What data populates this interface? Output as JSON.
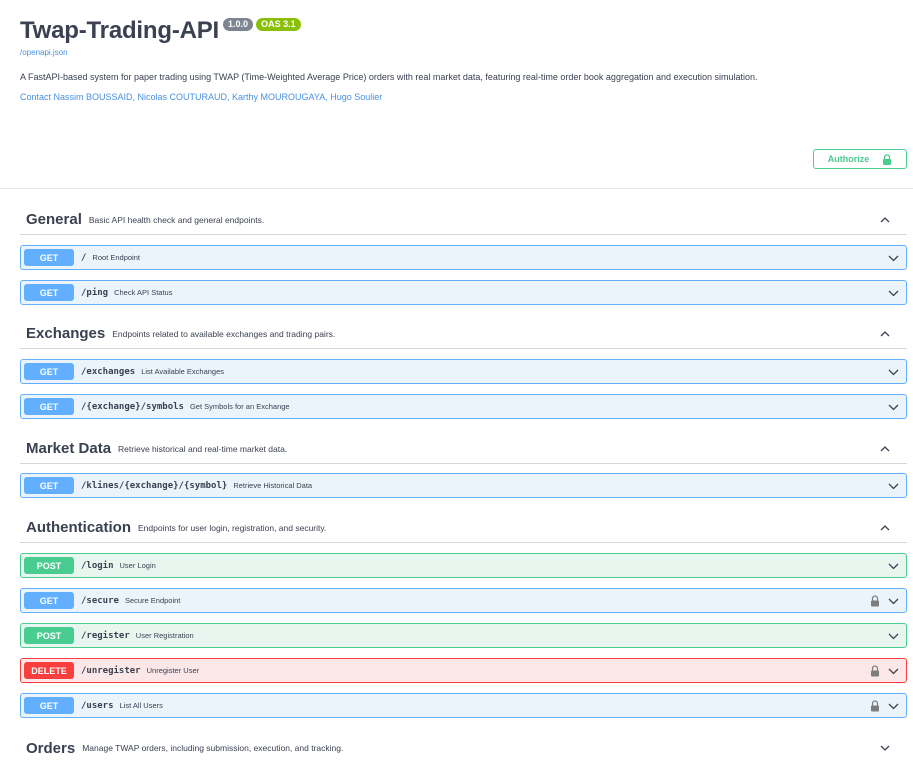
{
  "info": {
    "title": "Twap-Trading-API",
    "version": "1.0.0",
    "oas_badge": "OAS 3.1",
    "spec_link": "/openapi.json",
    "description": "A FastAPI-based system for paper trading using TWAP (Time-Weighted Average Price) orders with real market data, featuring real-time order book aggregation and execution simulation.",
    "contact": "Contact Nassim BOUSSAID, Nicolas COUTURAUD, Karthy MOUROUGAYA, Hugo Soulier"
  },
  "authorize": {
    "label": "Authorize",
    "icon": "lock-icon"
  },
  "colors": {
    "get": "#61affe",
    "post": "#49cc90",
    "delete": "#f93e3e",
    "accent_link": "#4990e2"
  },
  "tags": [
    {
      "name": "General",
      "description": "Basic API health check and general endpoints.",
      "expanded": true
    },
    {
      "name": "Exchanges",
      "description": "Endpoints related to available exchanges and trading pairs.",
      "expanded": true
    },
    {
      "name": "Market Data",
      "description": "Retrieve historical and real-time market data.",
      "expanded": true
    },
    {
      "name": "Authentication",
      "description": "Endpoints for user login, registration, and security.",
      "expanded": true
    },
    {
      "name": "Orders",
      "description": "Manage TWAP orders, including submission, execution, and tracking.",
      "expanded": false
    }
  ],
  "operations": [
    {
      "method": "GET",
      "path": "/",
      "summary": "Root Endpoint",
      "locked": false
    },
    {
      "method": "GET",
      "path": "/ping",
      "summary": "Check API Status",
      "locked": false
    },
    {
      "method": "GET",
      "path": "/exchanges",
      "summary": "List Available Exchanges",
      "locked": false
    },
    {
      "method": "GET",
      "path": "/{exchange}/symbols",
      "summary": "Get Symbols for an Exchange",
      "locked": false
    },
    {
      "method": "GET",
      "path": "/klines/{exchange}/{symbol}",
      "summary": "Retrieve Historical Data",
      "locked": false
    },
    {
      "method": "POST",
      "path": "/login",
      "summary": "User Login",
      "locked": false
    },
    {
      "method": "GET",
      "path": "/secure",
      "summary": "Secure Endpoint",
      "locked": true
    },
    {
      "method": "POST",
      "path": "/register",
      "summary": "User Registration",
      "locked": false
    },
    {
      "method": "DELETE",
      "path": "/unregister",
      "summary": "Unregister User",
      "locked": true
    },
    {
      "method": "GET",
      "path": "/users",
      "summary": "List All Users",
      "locked": true
    }
  ]
}
